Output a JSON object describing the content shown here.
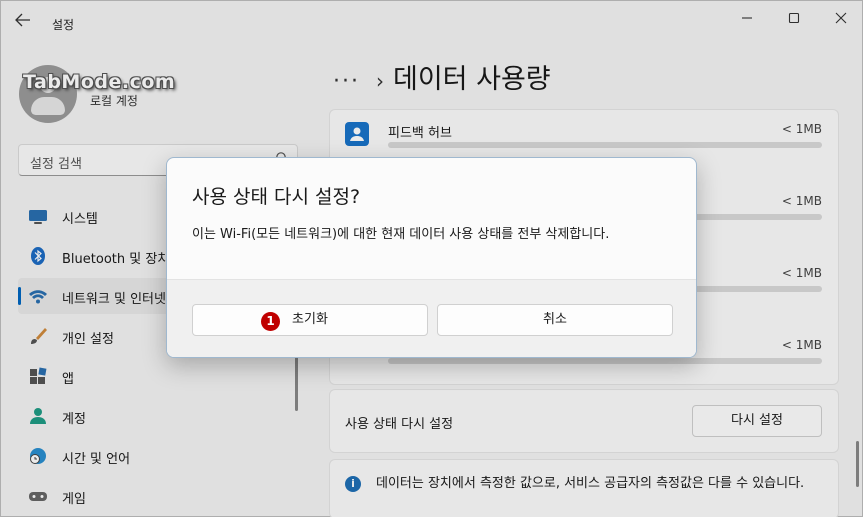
{
  "window": {
    "title": "설정",
    "back_icon": "back-arrow-icon"
  },
  "profile": {
    "watermark": "TabMode.com",
    "account_type": "로컬 계정"
  },
  "search": {
    "placeholder": "설정 검색"
  },
  "nav": [
    {
      "label": "시스템",
      "icon": "system-monitor-icon"
    },
    {
      "label": "Bluetooth 및 장치",
      "icon": "bluetooth-icon"
    },
    {
      "label": "네트워크 및 인터넷",
      "icon": "wifi-icon",
      "active": true
    },
    {
      "label": "개인 설정",
      "icon": "paintbrush-icon"
    },
    {
      "label": "앱",
      "icon": "apps-icon"
    },
    {
      "label": "계정",
      "icon": "account-icon"
    },
    {
      "label": "시간 및 언어",
      "icon": "time-language-icon"
    },
    {
      "label": "게임",
      "icon": "gamepad-icon"
    }
  ],
  "breadcrumb": {
    "dots": "···",
    "current": "데이터 사용량"
  },
  "apps": [
    {
      "name": "피드백 허브",
      "size": "< 1MB"
    },
    {
      "name": "",
      "size": "< 1MB"
    },
    {
      "name": "",
      "size": "< 1MB"
    },
    {
      "name": "",
      "size": "< 1MB"
    }
  ],
  "reset": {
    "label": "사용 상태 다시 설정",
    "button": "다시 설정"
  },
  "info": {
    "text": "데이터는 장치에서 측정한 값으로, 서비스 공급자의 측정값은 다를 수 있습니다."
  },
  "dialog": {
    "title": "사용 상태 다시 설정?",
    "message": "이는 Wi-Fi(모든 네트워크)에 대한 현재 데이터 사용 상태를 전부 삭제합니다.",
    "primary": "초기화",
    "secondary": "취소",
    "step_badge": "1"
  }
}
